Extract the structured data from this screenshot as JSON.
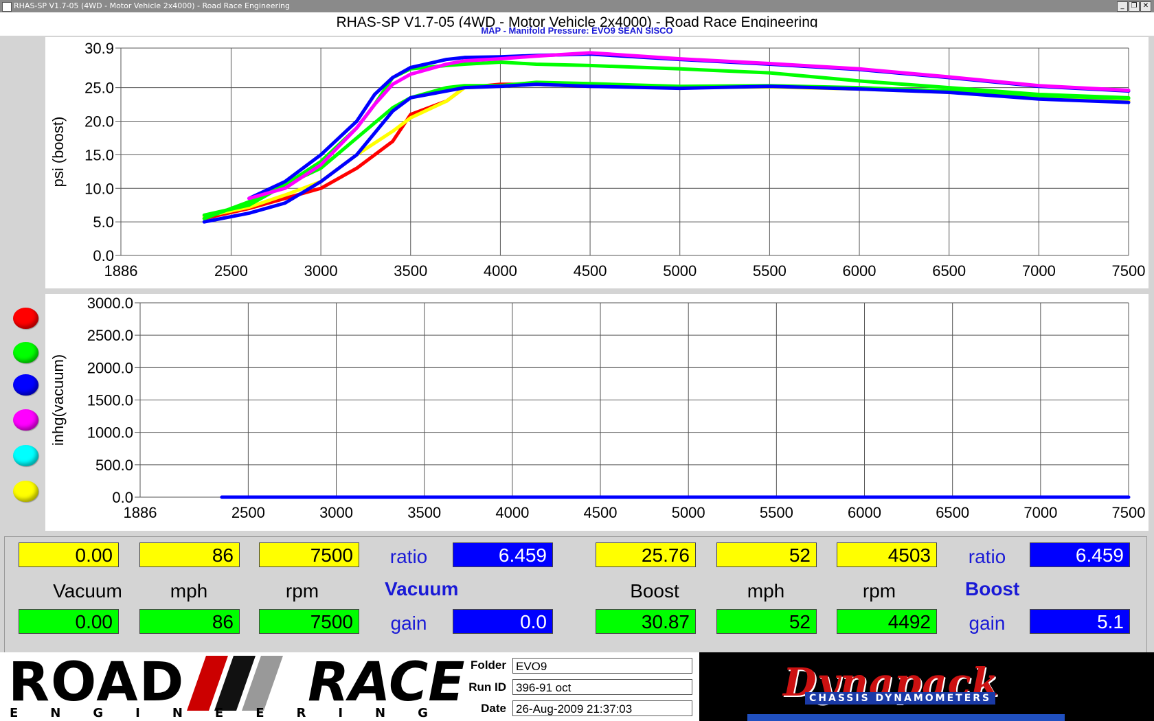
{
  "window": {
    "title": "RHAS-SP V1.7-05   (4WD - Motor Vehicle 2x4000) - Road Race Engineering",
    "app_title": "RHAS-SP V1.7-05   (4WD - Motor Vehicle 2x4000) - Road Race Engineering",
    "chart_title": "MAP - Manifold Pressure: EVO9 SEAN SISCO",
    "buttons": {
      "minimize": "_",
      "restore": "❐",
      "close": "✕"
    }
  },
  "legend": {
    "colors": [
      "#ff0000",
      "#00ff00",
      "#0000ff",
      "#ff00ff",
      "#00ffff",
      "#ffff00"
    ]
  },
  "chart_data": [
    {
      "type": "line",
      "ylabel": "psi (boost)",
      "xlabel": "",
      "xlim": [
        1886,
        7500
      ],
      "ylim": [
        0,
        30.9
      ],
      "x_ticks": [
        1886,
        2500,
        3000,
        3500,
        4000,
        4500,
        5000,
        5500,
        6000,
        6500,
        7000,
        7500
      ],
      "y_ticks": [
        {
          "value": 0,
          "label": "0.0"
        },
        {
          "value": 5,
          "label": "5.0"
        },
        {
          "value": 10,
          "label": "10.0"
        },
        {
          "value": 15,
          "label": "15.0"
        },
        {
          "value": 20,
          "label": "20.0"
        },
        {
          "value": 25,
          "label": "25.0"
        },
        {
          "value": 30.9,
          "label": "30.9"
        }
      ],
      "grid": true,
      "series": [
        {
          "color": "#ff0000",
          "x": [
            2350,
            2600,
            2800,
            3000,
            3200,
            3400,
            3500,
            3700,
            3800,
            4000,
            4200,
            4500,
            5000,
            5500,
            6000,
            6500,
            7000,
            7500
          ],
          "y": [
            5.5,
            7.0,
            8.5,
            10.0,
            13.0,
            17.0,
            21.0,
            23.0,
            25.0,
            25.5,
            25.5,
            25.2,
            25.0,
            25.2,
            24.8,
            24.5,
            23.5,
            23.0
          ]
        },
        {
          "color": "#ffff00",
          "x": [
            2350,
            2600,
            2800,
            3000,
            3200,
            3400,
            3500,
            3700,
            3800,
            4000,
            4200,
            4500,
            5000,
            5500,
            6000,
            6500,
            7000,
            7500
          ],
          "y": [
            5.8,
            7.2,
            9.0,
            11.0,
            15.0,
            18.5,
            20.5,
            23.0,
            25.0,
            25.2,
            25.5,
            25.3,
            25.0,
            25.1,
            24.8,
            24.3,
            23.6,
            23.0
          ]
        },
        {
          "color": "#00ff00",
          "x": [
            2350,
            2600,
            2800,
            3000,
            3200,
            3400,
            3500,
            3700,
            3800,
            4000,
            4200,
            4500,
            5000,
            5500,
            6000,
            6500,
            7000,
            7500
          ],
          "y": [
            6.0,
            7.5,
            10.5,
            13.0,
            17.5,
            22.0,
            23.5,
            25.0,
            25.3,
            25.3,
            25.8,
            25.6,
            25.2,
            25.3,
            25.0,
            24.5,
            23.8,
            23.4
          ]
        },
        {
          "color": "#0000ff",
          "x": [
            2350,
            2600,
            2800,
            3000,
            3200,
            3400,
            3500,
            3700,
            3800,
            4000,
            4200,
            4500,
            5000,
            5500,
            6000,
            6500,
            7000,
            7500
          ],
          "y": [
            5.0,
            6.3,
            7.8,
            11.0,
            15.0,
            21.5,
            23.5,
            24.5,
            25.0,
            25.2,
            25.5,
            25.2,
            24.9,
            25.2,
            24.8,
            24.3,
            23.3,
            22.8
          ]
        },
        {
          "color": "#00ff00",
          "x": [
            2350,
            2600,
            2800,
            3000,
            3200,
            3300,
            3400,
            3500,
            3700,
            3800,
            4000,
            4200,
            4500,
            5000,
            5500,
            6000,
            6500,
            7000,
            7500
          ],
          "y": [
            5.5,
            8.0,
            10.5,
            14.0,
            19.0,
            22.5,
            26.5,
            27.8,
            28.3,
            28.5,
            28.8,
            28.5,
            28.3,
            27.8,
            27.2,
            26.0,
            25.0,
            24.0,
            23.5
          ]
        },
        {
          "color": "#0000ff",
          "x": [
            2600,
            2800,
            3000,
            3200,
            3300,
            3400,
            3500,
            3700,
            3800,
            4000,
            4200,
            4500,
            5000,
            5500,
            6000,
            6500,
            7000,
            7500
          ],
          "y": [
            8.5,
            11.0,
            15.0,
            20.0,
            24.0,
            26.5,
            28.0,
            29.2,
            29.5,
            29.6,
            29.8,
            30.0,
            29.2,
            28.5,
            27.7,
            26.5,
            25.2,
            24.5
          ]
        },
        {
          "color": "#ff00ff",
          "x": [
            2600,
            2800,
            3000,
            3200,
            3300,
            3400,
            3500,
            3700,
            3800,
            4000,
            4200,
            4500,
            5000,
            5500,
            6000,
            6500,
            7000,
            7500
          ],
          "y": [
            8.5,
            10.0,
            13.5,
            19.0,
            22.5,
            25.5,
            27.0,
            28.5,
            29.0,
            29.3,
            29.7,
            30.2,
            29.3,
            28.6,
            27.8,
            26.6,
            25.3,
            24.6
          ]
        }
      ]
    },
    {
      "type": "line",
      "ylabel": "inhg(vacuum)",
      "xlabel": "",
      "xlim": [
        1886,
        7500
      ],
      "ylim": [
        0,
        3000
      ],
      "x_ticks": [
        1886,
        2500,
        3000,
        3500,
        4000,
        4500,
        5000,
        5500,
        6000,
        6500,
        7000,
        7500
      ],
      "y_ticks": [
        {
          "value": 0,
          "label": "0.0"
        },
        {
          "value": 500,
          "label": "500.0"
        },
        {
          "value": 1000,
          "label": "1000.0"
        },
        {
          "value": 1500,
          "label": "1500.0"
        },
        {
          "value": 2000,
          "label": "2000.0"
        },
        {
          "value": 2500,
          "label": "2500.0"
        },
        {
          "value": 3000,
          "label": "3000.0"
        }
      ],
      "grid": true,
      "series": [
        {
          "color": "#0000ff",
          "x": [
            2350,
            7500
          ],
          "y": [
            0,
            0
          ]
        }
      ]
    }
  ],
  "readouts": {
    "vacuum": {
      "section_label": "Vacuum",
      "labels": {
        "value": "Vacuum",
        "mph": "mph",
        "rpm": "rpm"
      },
      "yellow": {
        "value": "0.00",
        "mph": "86",
        "rpm": "7500"
      },
      "green": {
        "value": "0.00",
        "mph": "86",
        "rpm": "7500"
      },
      "ratio_label": "ratio",
      "ratio": "6.459",
      "gain_label": "gain",
      "gain": "0.0"
    },
    "boost": {
      "section_label": "Boost",
      "labels": {
        "value": "Boost",
        "mph": "mph",
        "rpm": "rpm"
      },
      "yellow": {
        "value": "25.76",
        "mph": "52",
        "rpm": "4503"
      },
      "green": {
        "value": "30.87",
        "mph": "52",
        "rpm": "4492"
      },
      "ratio_label": "ratio",
      "ratio": "6.459",
      "gain_label": "gain",
      "gain": "5.1"
    }
  },
  "footer": {
    "logo_road": "ROAD",
    "logo_race": "RACE",
    "logo_engineering": "ENGINEERING",
    "folder_label": "Folder",
    "folder_value": "EVO9",
    "runid_label": "Run ID",
    "runid_value": "396-91 oct",
    "date_label": "Date",
    "date_value": "26-Aug-2009  21:37:03",
    "dyna_logo": "Dynapack",
    "dyna_sub": "CHASSIS DYNAMOMETERS"
  }
}
